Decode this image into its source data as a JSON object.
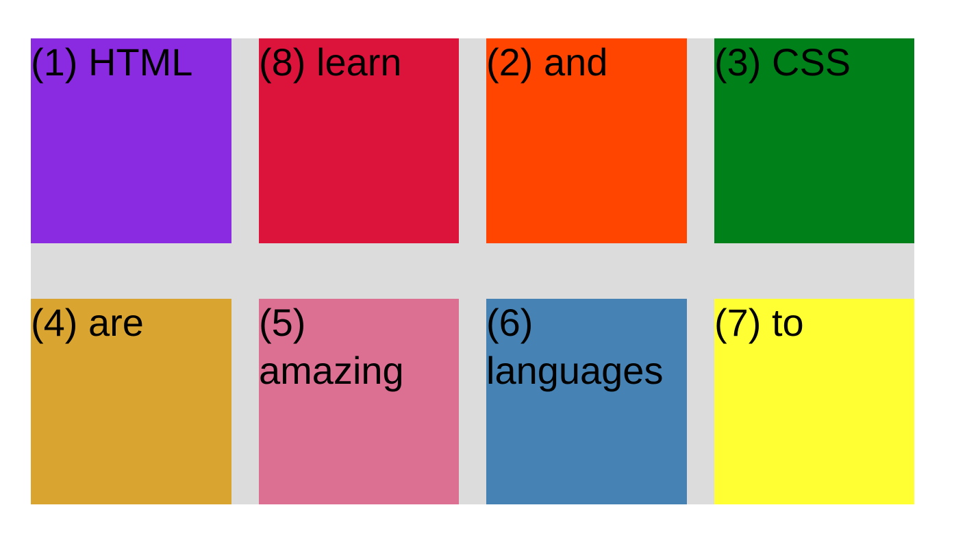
{
  "cells": [
    {
      "text": "(1) HTML",
      "color": "#8a2be2"
    },
    {
      "text": "(8) learn",
      "color": "#dc143c"
    },
    {
      "text": "(2) and",
      "color": "#ff4500"
    },
    {
      "text": "(3) CSS",
      "color": "#008018"
    },
    {
      "text": "(4) are",
      "color": "#daa430"
    },
    {
      "text": "(5) amazing",
      "color": "#db7093"
    },
    {
      "text": "(6) languages",
      "color": "#4682b4"
    },
    {
      "text": "(7) to",
      "color": "#ffff33"
    }
  ]
}
